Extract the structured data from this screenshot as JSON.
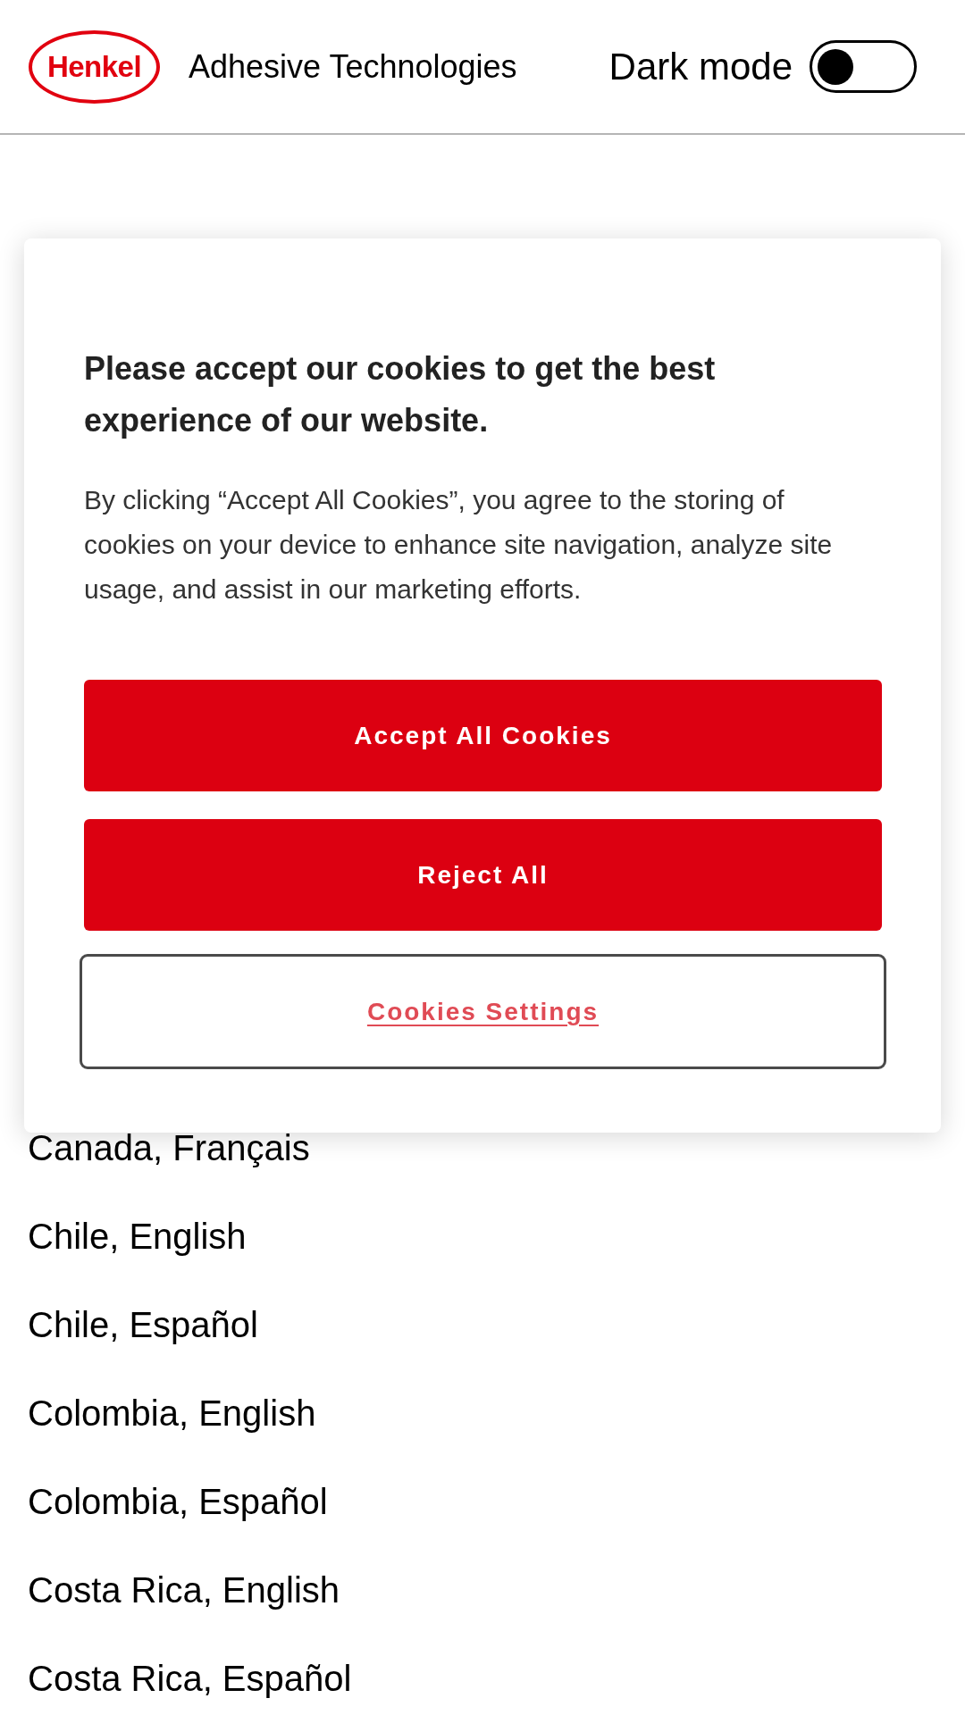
{
  "header": {
    "logo": "Henkel",
    "title": "Adhesive Technologies",
    "dark_mode": {
      "label": "Dark mode",
      "on": false
    }
  },
  "cookie_dialog": {
    "heading": "Please accept our cookies to get the best experience of our website.",
    "text": "By clicking “Accept All Cookies”, you agree to the storing of cookies on your device to enhance site navigation, analyze site usage, and assist in our marketing efforts.",
    "buttons": [
      {
        "label": "Accept All Cookies",
        "kind": "primary"
      },
      {
        "label": "Reject All",
        "kind": "primary"
      },
      {
        "label": "Cookies Settings",
        "kind": "outline"
      }
    ]
  },
  "country_list": [
    "Canada, Français",
    "Chile, English",
    "Chile, Español",
    "Colombia, English",
    "Colombia, Español",
    "Costa Rica, English",
    "Costa Rica, Español"
  ]
}
